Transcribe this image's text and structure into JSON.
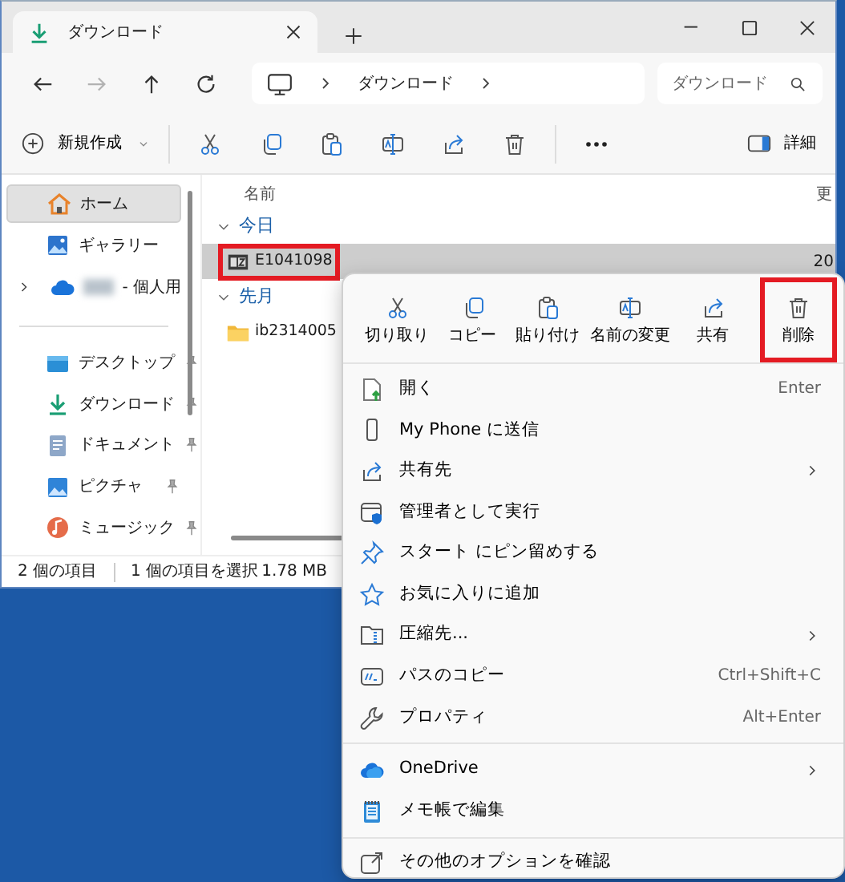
{
  "window": {
    "tab_title": "ダウンロード"
  },
  "nav_buttons": [
    {
      "kind": "back",
      "disabled": false
    },
    {
      "kind": "forward",
      "disabled": true
    },
    {
      "kind": "up",
      "disabled": false
    },
    {
      "kind": "refresh",
      "disabled": false
    }
  ],
  "address": {
    "segments": [
      "ダウンロード"
    ]
  },
  "search": {
    "placeholder": "ダウンロード"
  },
  "toolbar": {
    "new_label": "新規作成",
    "tools": [
      {
        "kind": "cut"
      },
      {
        "kind": "copy"
      },
      {
        "kind": "paste"
      },
      {
        "kind": "rename"
      },
      {
        "kind": "share"
      },
      {
        "kind": "delete"
      }
    ],
    "details_label": "詳細"
  },
  "sidebar": {
    "items": [
      {
        "kind": "home",
        "label": "ホーム",
        "selected": true,
        "expandable": false,
        "redacted": false
      },
      {
        "kind": "gallery",
        "label": "ギャラリー",
        "selected": false,
        "expandable": false,
        "redacted": false
      },
      {
        "kind": "cloud",
        "label": "- 個人用",
        "selected": false,
        "expandable": true,
        "redacted": true
      }
    ],
    "pinned": [
      {
        "kind": "desktop",
        "label": "デスクトップ",
        "selected": false
      },
      {
        "kind": "download",
        "label": "ダウンロード",
        "selected": false
      },
      {
        "kind": "document",
        "label": "ドキュメント",
        "selected": false
      },
      {
        "kind": "pictures",
        "label": "ピクチャ",
        "selected": false
      },
      {
        "kind": "music",
        "label": "ミュージック",
        "selected": false
      }
    ]
  },
  "content": {
    "columns": [
      "名前",
      "更"
    ],
    "groups": [
      {
        "label": "今日",
        "expanded": true,
        "files": [
          {
            "kind": "archive",
            "name": "E1041098",
            "column_2": "20",
            "selected": true,
            "highlighted": true
          }
        ]
      },
      {
        "label": "先月",
        "expanded": true,
        "files": [
          {
            "kind": "folder",
            "name": "ib2314005",
            "selected": false,
            "highlighted": false
          }
        ]
      }
    ]
  },
  "status_bar": {
    "count": "2 個の項目",
    "selection": "1 個の項目を選択",
    "size": "1.78 MB"
  },
  "context_menu": {
    "actions": [
      {
        "kind": "cut",
        "label": "切り取り",
        "highlighted": false
      },
      {
        "kind": "copy",
        "label": "コピー",
        "highlighted": false
      },
      {
        "kind": "paste",
        "label": "貼り付け",
        "highlighted": false
      },
      {
        "kind": "rename",
        "label": "名前の変更",
        "highlighted": false
      },
      {
        "kind": "share",
        "label": "共有",
        "highlighted": false
      },
      {
        "kind": "delete",
        "label": "削除",
        "highlighted": true
      }
    ],
    "sections": [
      {
        "items": [
          {
            "kind": "open",
            "label": "開く",
            "shortcut": "Enter",
            "submenu": false
          },
          {
            "kind": "phone",
            "label": "My Phone に送信",
            "submenu": false
          },
          {
            "kind": "share",
            "label": "共有先",
            "submenu": true
          },
          {
            "kind": "admin",
            "label": "管理者として実行",
            "submenu": false
          },
          {
            "kind": "pin",
            "label": "スタート にピン留めする",
            "submenu": false
          },
          {
            "kind": "star",
            "label": "お気に入りに追加",
            "submenu": false
          },
          {
            "kind": "compress",
            "label": "圧縮先...",
            "submenu": true
          },
          {
            "kind": "path",
            "label": "パスのコピー",
            "shortcut": "Ctrl+Shift+C",
            "submenu": false
          },
          {
            "kind": "wrench",
            "label": "プロパティ",
            "shortcut": "Alt+Enter",
            "submenu": false
          }
        ]
      },
      {
        "items": [
          {
            "kind": "onedrive",
            "label": "OneDrive",
            "submenu": true
          },
          {
            "kind": "notepad",
            "label": "メモ帳で編集",
            "submenu": false
          }
        ]
      },
      {
        "items": [
          {
            "kind": "more",
            "label": "その他のオプションを確認",
            "submenu": false
          }
        ]
      }
    ]
  }
}
